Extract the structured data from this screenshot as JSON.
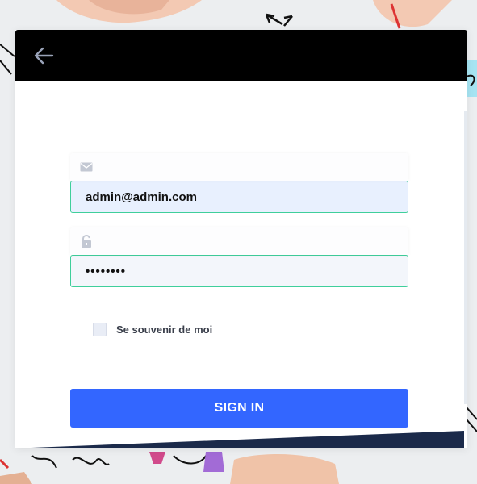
{
  "header": {
    "back_icon": "arrow-left-icon"
  },
  "form": {
    "email": {
      "icon": "envelope-icon",
      "value": "admin@admin.com"
    },
    "password": {
      "icon": "unlock-icon",
      "value": "••••••••"
    },
    "remember_label": "Se souvenir de moi",
    "remember_checked": false,
    "submit_label": "SIGN IN"
  },
  "colors": {
    "header_bg": "#000000",
    "accent_button": "#3366ff",
    "input_border": "#3fcf9b",
    "band": "#1b2a4a"
  }
}
